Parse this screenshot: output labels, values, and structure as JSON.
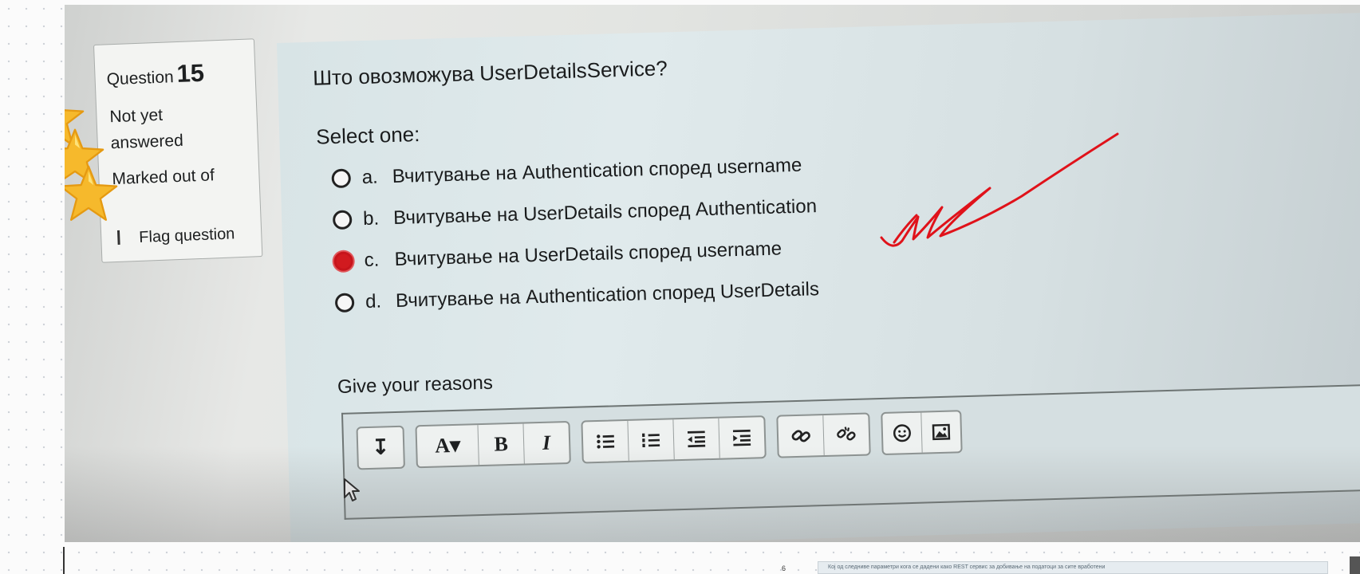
{
  "question_card": {
    "question_label": "Question",
    "question_number": "15",
    "status": [
      "Not yet",
      "answered"
    ],
    "marked": [
      "Marked out of",
      ""
    ],
    "flag_label": "Flag question"
  },
  "question": {
    "text": "Што овозможува UserDetailsService?",
    "select_label": "Select one:",
    "options": [
      {
        "letter": "a.",
        "text": "Вчитување на Authentication според username",
        "selected": false
      },
      {
        "letter": "b.",
        "text": "Вчитување на UserDetails според Authentication",
        "selected": false
      },
      {
        "letter": "c.",
        "text": "Вчитување на UserDetails според username",
        "selected": true
      },
      {
        "letter": "d.",
        "text": "Вчитување на Authentication според UserDetails",
        "selected": false
      }
    ],
    "reasons_label": "Give your reasons"
  },
  "toolbar": {
    "expand_glyph": "↧",
    "font_glyph": "A▾",
    "bold_glyph": "B",
    "italic_glyph": "I"
  },
  "bottom": {
    "page_number": "6",
    "next_question_snippet": "Кој од следниве параметри кога се дадени како REST сервис за добивање на податоци за сите вработени"
  },
  "colors": {
    "selected_radio": "#d11a1f",
    "red_ink": "#e0121a"
  }
}
